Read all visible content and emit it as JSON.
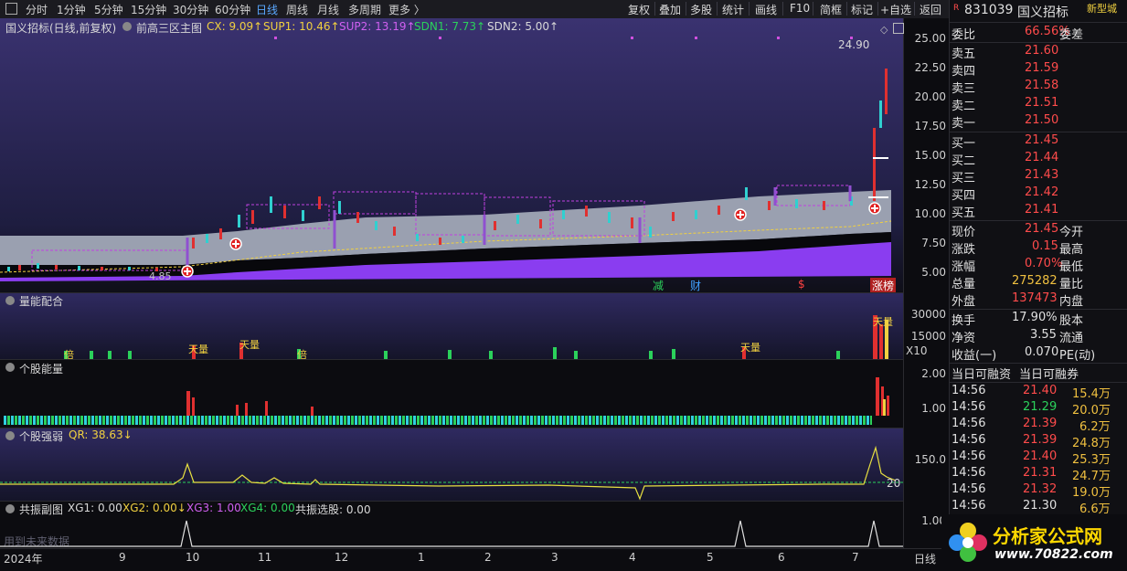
{
  "toolbar": {
    "periods": [
      "分时",
      "1分钟",
      "5分钟",
      "15分钟",
      "30分钟",
      "60分钟",
      "日线",
      "周线",
      "月线",
      "多周期",
      "更多 〉"
    ],
    "active_period": "日线",
    "tools": [
      "复权",
      "叠加",
      "多股",
      "统计",
      "画线",
      "F10",
      "简框",
      "标记",
      "+自选",
      "返回"
    ]
  },
  "main_panel": {
    "stock_label": "国义招标(日线,前复权)",
    "indicator": "前高三区主图",
    "cx": "CX: 9.09↑",
    "sup1": "SUP1: 10.46↑",
    "sup2": "SUP2: 13.19↑",
    "sdn1": "SDN1: 7.73↑",
    "sdn2": "SDN2: 5.00↑",
    "high_label": "24.90",
    "low_label": "4.85",
    "axis": [
      "25.00",
      "22.50",
      "20.00",
      "17.50",
      "15.00",
      "12.50",
      "10.00",
      "7.50",
      "5.00"
    ],
    "markers": [
      "减",
      "财",
      "$",
      "涨榜"
    ]
  },
  "volume_panel": {
    "title": "量能配合",
    "axis": [
      "30000",
      "15000"
    ],
    "unit": "X10",
    "labels": [
      "倍",
      "天量",
      "天量",
      "倍",
      "天量",
      "天量"
    ]
  },
  "energy_panel": {
    "title": "个股能量",
    "axis": [
      "2.00",
      "1.00"
    ]
  },
  "strength_panel": {
    "title": "个股强弱",
    "qr": "QR: 38.63↓",
    "axis": [
      "150.0"
    ],
    "right_label": "20"
  },
  "resonance_panel": {
    "title": "共振副图",
    "xg1": "XG1: 0.00",
    "xg2": "XG2: 0.00↓",
    "xg3": "XG3: 1.00",
    "xg4": "XG4: 0.00",
    "pick": "共振选股: 0.00",
    "note": "用到未来数据",
    "axis": [
      "1.00"
    ]
  },
  "dates": [
    "2024年",
    "9",
    "10",
    "11",
    "12",
    "1",
    "2",
    "3",
    "4",
    "5",
    "6",
    "7"
  ],
  "period_label": "日线",
  "quote": {
    "code": "831039",
    "name": "国义招标",
    "badge": "新型城",
    "ratio_label": "委比",
    "ratio_value": "66.56%",
    "diff_label": "委差",
    "asks": [
      {
        "label": "卖五",
        "value": "21.60"
      },
      {
        "label": "卖四",
        "value": "21.59"
      },
      {
        "label": "卖三",
        "value": "21.58"
      },
      {
        "label": "卖二",
        "value": "21.51"
      },
      {
        "label": "卖一",
        "value": "21.50"
      }
    ],
    "bids": [
      {
        "label": "买一",
        "value": "21.45"
      },
      {
        "label": "买二",
        "value": "21.44"
      },
      {
        "label": "买三",
        "value": "21.43"
      },
      {
        "label": "买四",
        "value": "21.42"
      },
      {
        "label": "买五",
        "value": "21.41"
      }
    ],
    "stats": [
      {
        "l": "现价",
        "v": "21.45",
        "r": "今开"
      },
      {
        "l": "涨跌",
        "v": "0.15",
        "r": "最高"
      },
      {
        "l": "涨幅",
        "v": "0.70%",
        "r": "最低"
      },
      {
        "l": "总量",
        "v": "275282",
        "r": "量比"
      },
      {
        "l": "外盘",
        "v": "137473",
        "r": "内盘"
      }
    ],
    "stats2": [
      {
        "l": "换手",
        "v": "17.90%",
        "r": "股本"
      },
      {
        "l": "净资",
        "v": "3.55",
        "r": "流通"
      },
      {
        "l": "收益(一)",
        "v": "0.070",
        "r": "PE(动)"
      }
    ],
    "margin_labels": [
      "当日可融资",
      "当日可融券"
    ],
    "ticks": [
      {
        "t": "14:56",
        "p": "21.40",
        "v": "15.4万"
      },
      {
        "t": "14:56",
        "p": "21.29",
        "v": "20.0万"
      },
      {
        "t": "14:56",
        "p": "21.39",
        "v": "6.2万"
      },
      {
        "t": "14:56",
        "p": "21.39",
        "v": "24.8万"
      },
      {
        "t": "14:56",
        "p": "21.40",
        "v": "25.3万"
      },
      {
        "t": "14:56",
        "p": "21.31",
        "v": "24.7万"
      },
      {
        "t": "14:56",
        "p": "21.32",
        "v": "19.0万"
      },
      {
        "t": "14:56",
        "p": "21.30",
        "v": "6.6万"
      }
    ]
  },
  "logo": {
    "text": "分析家公式网",
    "url": "www.70822.com"
  }
}
